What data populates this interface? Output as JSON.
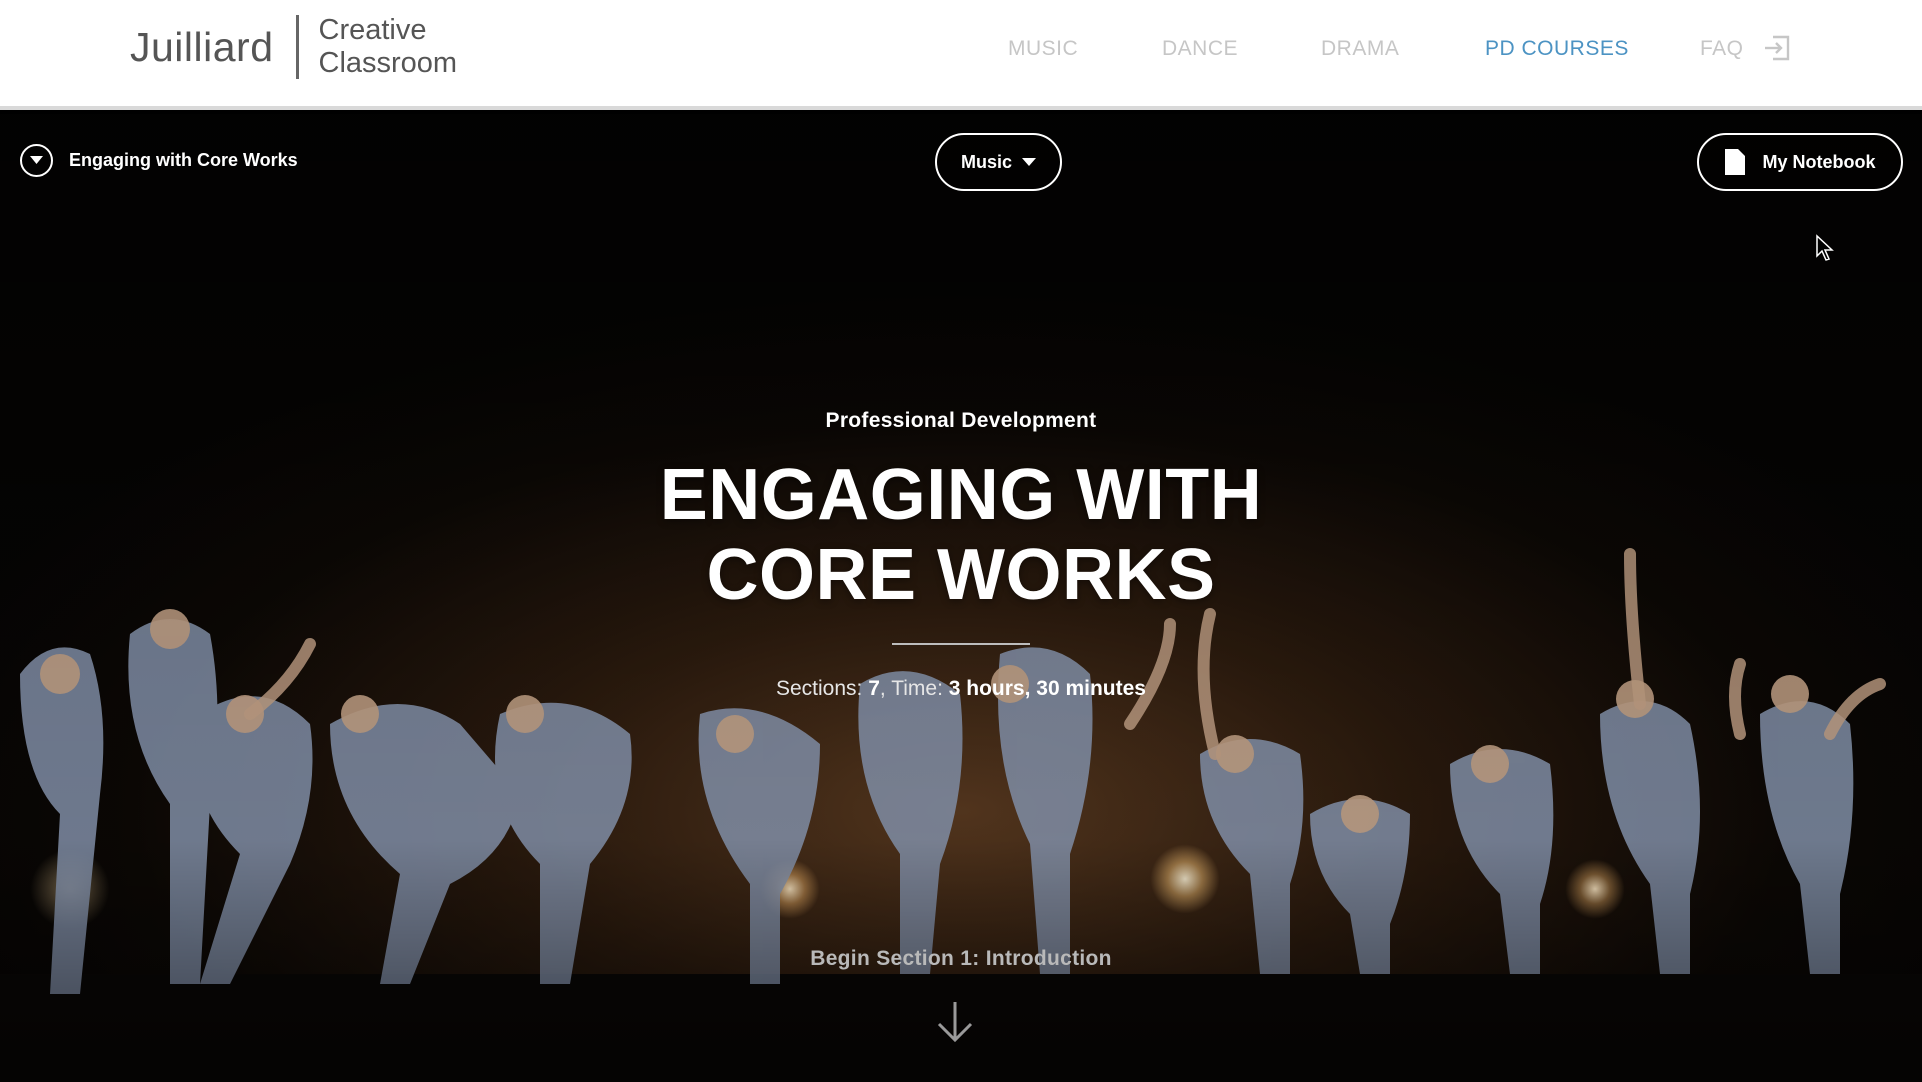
{
  "header": {
    "logo": {
      "main": "Juilliard",
      "sub_line1": "Creative",
      "sub_line2": "Classroom"
    },
    "nav": [
      {
        "label": "MUSIC",
        "active": false
      },
      {
        "label": "DANCE",
        "active": false
      },
      {
        "label": "DRAMA",
        "active": false
      },
      {
        "label": "PD COURSES",
        "active": true
      },
      {
        "label": "FAQ",
        "active": false
      }
    ],
    "login_icon": "sign-in-icon"
  },
  "hero": {
    "course_toggle_label": "Engaging with Core Works",
    "discipline_select": "Music",
    "notebook_label": "My Notebook",
    "eyebrow": "Professional Development",
    "title": "ENGAGING WITH CORE WORKS",
    "meta": {
      "sections_label": "Sections: ",
      "sections_value": "7",
      "time_label": ", Time: ",
      "time_value": "3 hours, 30 minutes"
    },
    "begin_label": "Begin Section 1: Introduction"
  },
  "colors": {
    "nav_inactive": "#c6c6c6",
    "nav_active": "#4c93c3",
    "logo_text": "#555555"
  }
}
